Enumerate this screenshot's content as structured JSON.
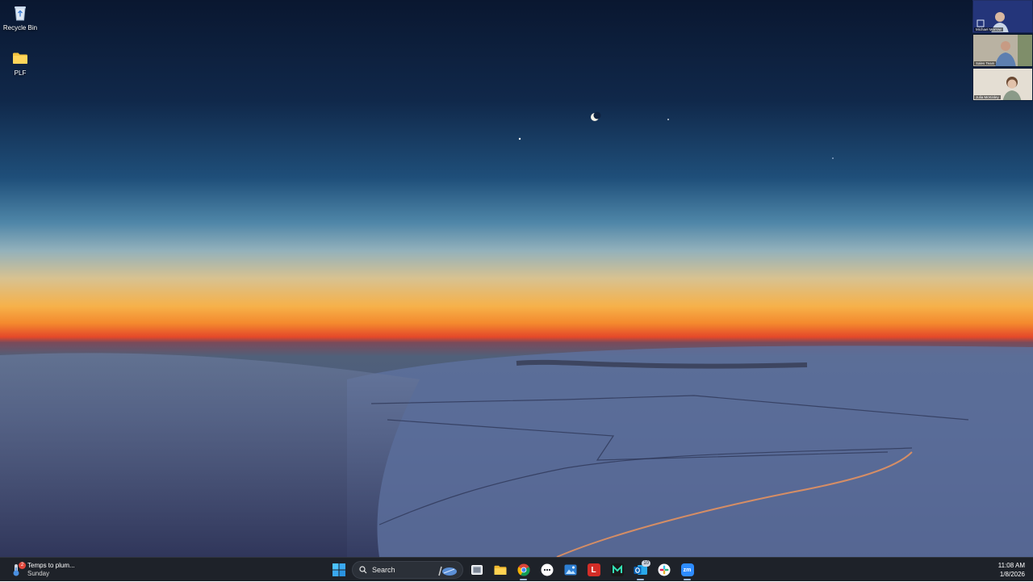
{
  "desktop": {
    "icons": [
      {
        "label": "Recycle Bin",
        "icon": "recycle-bin-icon"
      },
      {
        "label": "PLF",
        "icon": "folder-icon"
      }
    ]
  },
  "meeting": {
    "participants": [
      {
        "name": "Michael Morrow"
      },
      {
        "name": "Sales Team"
      },
      {
        "name": "Julia McKinley"
      }
    ]
  },
  "taskbar": {
    "weather": {
      "title": "Temps to plum...",
      "subtitle": "Sunday",
      "badge": "2"
    },
    "search": {
      "label": "Search"
    },
    "apps": [
      {
        "name": "start-icon"
      },
      {
        "name": "task-view-icon"
      },
      {
        "name": "file-explorer-icon"
      },
      {
        "name": "chrome-icon"
      },
      {
        "name": "messenger-icon"
      },
      {
        "name": "photos-icon"
      },
      {
        "name": "lastpass-icon",
        "letter": "L"
      },
      {
        "name": "m-app-icon"
      },
      {
        "name": "outlook-icon",
        "badge": "10"
      },
      {
        "name": "slack-icon"
      },
      {
        "name": "zoom-icon",
        "text": "zm"
      }
    ],
    "clock": {
      "time": "11:08 AM",
      "date": "1/8/2026"
    }
  },
  "colors": {
    "taskbar_bg": "#1e2229",
    "accent": "#2d8cff",
    "sky_top": "#0b1a33",
    "horizon": "#f4a23a"
  }
}
